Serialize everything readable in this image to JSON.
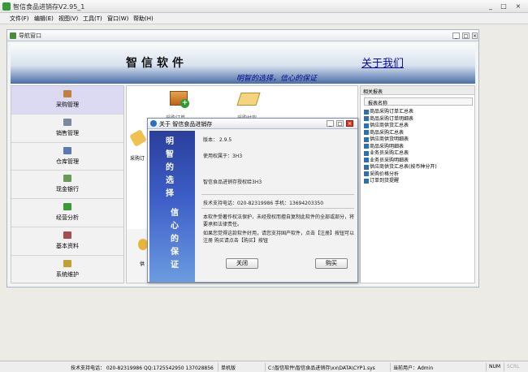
{
  "app": {
    "title": "智信食品进销存V2.95_1",
    "window_buttons": [
      "_",
      "□",
      "×"
    ]
  },
  "menu": [
    "文件(F)",
    "编辑(E)",
    "视图(V)",
    "工具(T)",
    "窗口(W)",
    "帮助(H)"
  ],
  "nav_window": {
    "title": "导航窗口",
    "banner": {
      "brand": "智信软件",
      "about_link": "关于我们",
      "slogan": "明智的选择，信心的保证"
    },
    "sidebar": [
      {
        "label": "采购管理",
        "icon": "purchase-icon",
        "color": "#c08040"
      },
      {
        "label": "销售管理",
        "icon": "sales-icon",
        "color": "#7a8a9a"
      },
      {
        "label": "仓库管理",
        "icon": "warehouse-icon",
        "color": "#5a7ab0"
      },
      {
        "label": "现金银行",
        "icon": "cash-icon",
        "color": "#6a9a5a"
      },
      {
        "label": "经营分析",
        "icon": "analysis-icon",
        "color": "#3a9a3a"
      },
      {
        "label": "基本资料",
        "icon": "basic-data-icon",
        "color": "#a05050"
      },
      {
        "label": "系统维护",
        "icon": "maintenance-icon",
        "color": "#c0a030"
      }
    ],
    "content": {
      "procure_label": "采购订",
      "bottom_card_label": "供",
      "ghost_label_1": "采购订单",
      "ghost_label_2": "采购付款"
    },
    "reports": {
      "panel_title": "相关报表",
      "column": "报表名称",
      "items": [
        "商品采购订单汇总表",
        "商品采购订单明细表",
        "供应商供货汇总表",
        "商品采购汇总表",
        "供应商供货明细表",
        "商品采购明细表",
        "业务员采购汇总表",
        "业务员采购明细表",
        "供应商供货汇总表(按币种分开)",
        "采购价格分析",
        "订单到货提醒"
      ]
    }
  },
  "about_dialog": {
    "title": "关于 智信食品进销存",
    "side_text": [
      "明",
      "智",
      "的",
      "选",
      "择",
      "信",
      "心",
      "的",
      "保",
      "证"
    ],
    "version": "版本： 2.9.5",
    "licensed_to": "使用权属于：3H3",
    "license_text": "智信食品进销存授权给3H3",
    "support": "技术支持电话：020-82319986 手机：13694203350",
    "copyright": "本软件受著作权法保护，未经授权而擅自复制此软件的全部或部分，将要承担法律责任。",
    "register_hint": "如果您觉得这款软件好用，请您支持国产软件，点击【注册】按钮可以注册 购买请点击【购买】按钮",
    "close_button": "关闭",
    "buy_button": "购买",
    "window_buttons": [
      "_",
      "□",
      "×"
    ]
  },
  "status_bar": {
    "support": "技术支持电话： 020-82319986 QQ:1725542950 137028856",
    "edition": "单机版",
    "path": "C:\\智信软件\\智信食品进销存\\xx\\DATA\\CYP1.sys",
    "current_user": "当前用户：Admin",
    "num": "NUM",
    "scrl": "SCRL"
  }
}
